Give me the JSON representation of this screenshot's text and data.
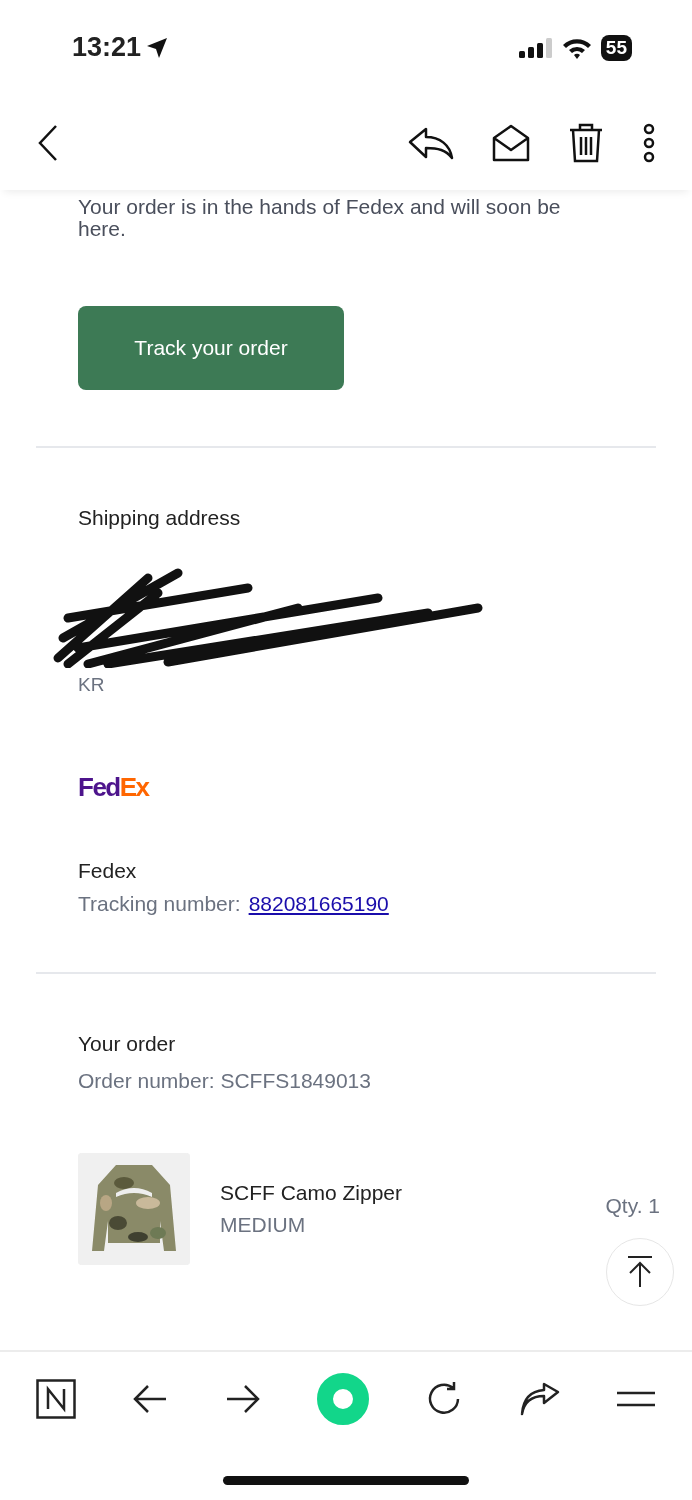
{
  "status_bar": {
    "time": "13:21",
    "battery": "55"
  },
  "intro": "Your order is in the hands of Fedex and will soon be here.",
  "track_button": "Track your order",
  "shipping": {
    "heading": "Shipping address",
    "redacted": true,
    "visible_lines": [
      "KR"
    ]
  },
  "carrier": {
    "logo_parts": [
      {
        "text": "Fed",
        "color": "#4d148c"
      },
      {
        "text": "Ex",
        "color": "#ff6600"
      }
    ],
    "name": "Fedex",
    "tracking_label": "Tracking number:",
    "tracking_number": "882081665190"
  },
  "order": {
    "heading": "Your order",
    "number": "Order number: SCFFS1849013",
    "items": [
      {
        "kind": "picture",
        "name": "SCFF Camo Zipper",
        "variant": "MEDIUM",
        "qty": "Qty. 1"
      }
    ]
  }
}
